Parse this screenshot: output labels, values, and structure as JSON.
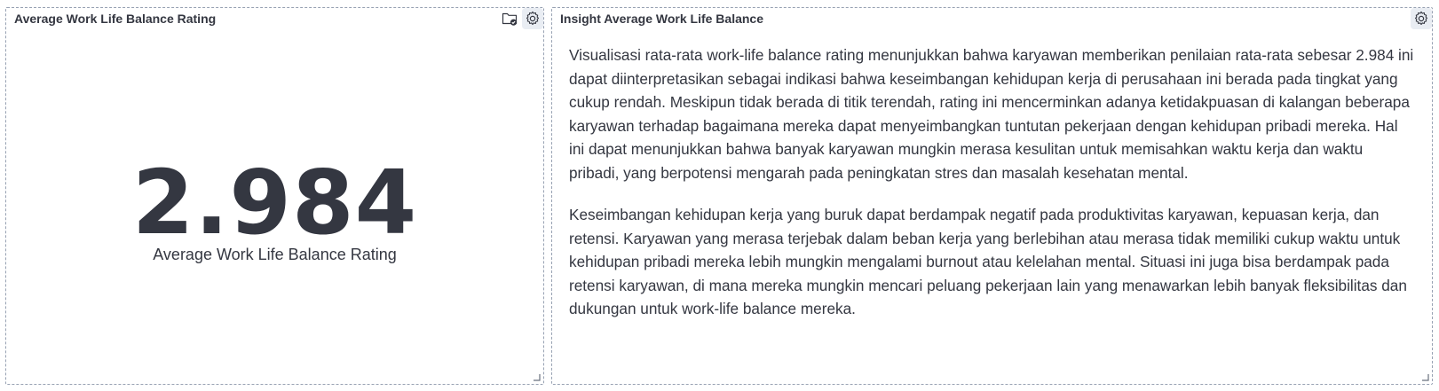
{
  "left_panel": {
    "title": "Average Work Life Balance Rating",
    "icons": [
      "folder-check-icon",
      "gear-icon"
    ],
    "metric": {
      "value": "2.984",
      "label": "Average Work Life Balance Rating"
    }
  },
  "right_panel": {
    "title": "Insight Average Work Life Balance",
    "icons": [
      "gear-icon"
    ],
    "paragraphs": [
      "Visualisasi rata-rata work-life balance rating menunjukkan bahwa karyawan memberikan penilaian rata-rata sebesar 2.984 ini dapat diinterpretasikan sebagai indikasi bahwa keseimbangan kehidupan kerja di perusahaan ini berada pada tingkat yang cukup rendah. Meskipun tidak berada di titik terendah, rating ini mencerminkan adanya ketidakpuasan di kalangan beberapa karyawan terhadap bagaimana mereka dapat menyeimbangkan tuntutan pekerjaan dengan kehidupan pribadi mereka. Hal ini dapat menunjukkan bahwa banyak karyawan mungkin merasa kesulitan untuk memisahkan waktu kerja dan waktu pribadi, yang berpotensi mengarah pada peningkatan stres dan masalah kesehatan mental.",
      "Keseimbangan kehidupan kerja yang buruk dapat berdampak negatif pada produktivitas karyawan, kepuasan kerja, dan retensi. Karyawan yang merasa terjebak dalam beban kerja yang berlebihan atau merasa tidak memiliki cukup waktu untuk kehidupan pribadi mereka lebih mungkin mengalami burnout atau kelelahan mental. Situasi ini juga bisa berdampak pada retensi karyawan, di mana mereka mungkin mencari peluang pekerjaan lain yang menawarkan lebih banyak fleksibilitas dan dukungan untuk work-life balance mereka."
    ]
  }
}
